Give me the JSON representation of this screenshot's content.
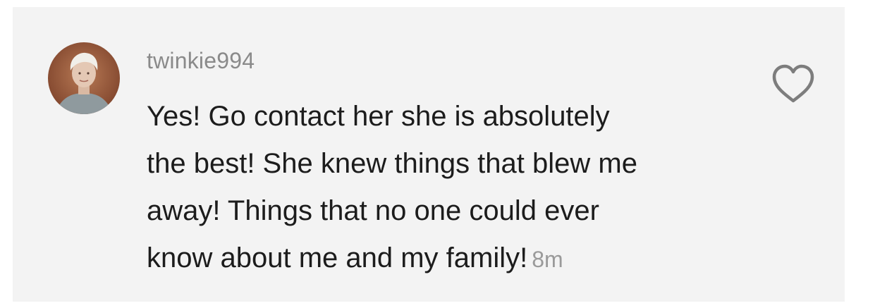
{
  "comment": {
    "username": "twinkie994",
    "text_lines": [
      "Yes! Go contact her she is absolutely",
      "the best! She knew things that blew me",
      "away! Things that no one could ever",
      "know about me and my family!"
    ],
    "time": "8m",
    "like_icon": "heart-outline-icon"
  }
}
